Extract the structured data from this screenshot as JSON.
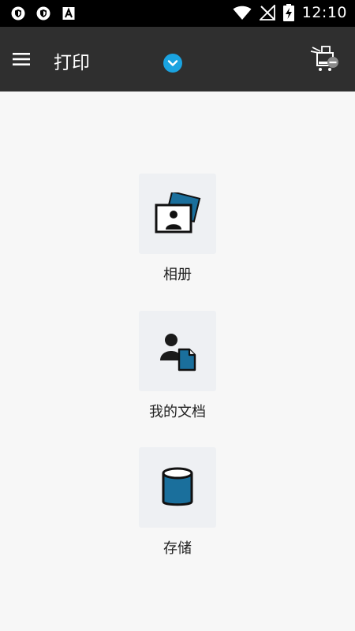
{
  "status_bar": {
    "time": "12:10",
    "left_icons": [
      "shield-icon",
      "shield-icon",
      "text-a-icon"
    ],
    "right_icons": [
      "wifi-icon",
      "no-signal-icon",
      "battery-charging-icon"
    ]
  },
  "app_bar": {
    "title": "打印",
    "menu_icon": "hamburger-menu-icon",
    "dropdown_icon": "chevron-down-icon",
    "printer_icon": "printer-disconnected-icon"
  },
  "tiles": [
    {
      "label": "相册",
      "icon": "photo-album-icon"
    },
    {
      "label": "我的文档",
      "icon": "person-document-icon"
    },
    {
      "label": "存储",
      "icon": "storage-cylinder-icon"
    }
  ],
  "colors": {
    "status_bar_bg": "#000000",
    "app_bar_bg": "#2f2f2f",
    "accent": "#1aa3e0",
    "icon_blue": "#1a6f9c",
    "page_bg": "#f7f7f7",
    "tile_bg": "#eef0f3"
  }
}
